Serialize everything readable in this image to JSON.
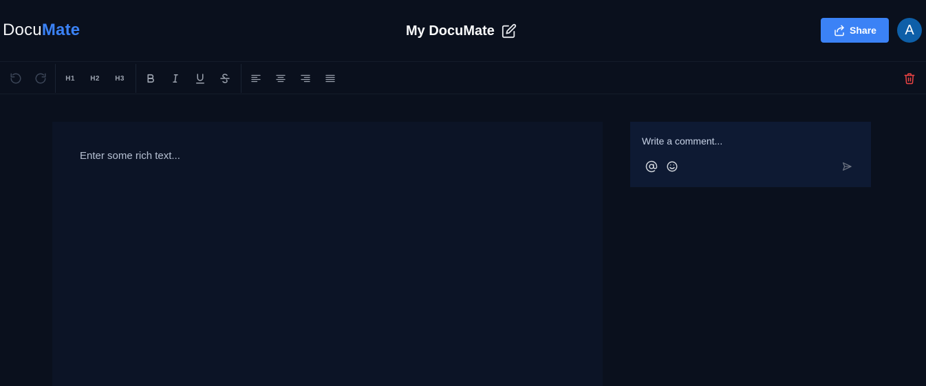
{
  "header": {
    "logo_part1": "Docu",
    "logo_part2": "Mate",
    "doc_title": "My DocuMate",
    "share_label": "Share",
    "avatar_initial": "A"
  },
  "toolbar": {
    "h1": "H1",
    "h2": "H2",
    "h3": "H3",
    "buttons": [
      "undo-icon",
      "redo-icon",
      "bold-icon",
      "italic-icon",
      "underline-icon",
      "strikethrough-icon",
      "align-left-icon",
      "align-center-icon",
      "align-right-icon",
      "align-justify-icon",
      "trash-icon"
    ]
  },
  "editor": {
    "placeholder": "Enter some rich text..."
  },
  "comments": {
    "placeholder": "Write a comment...",
    "icons": [
      "at-icon",
      "smile-icon",
      "send-icon"
    ]
  },
  "colors": {
    "background": "#0a101d",
    "accent": "#3b82f6",
    "editor_bg": "#0c1426",
    "comment_bg": "#0e1a33",
    "danger": "#ef4444"
  }
}
